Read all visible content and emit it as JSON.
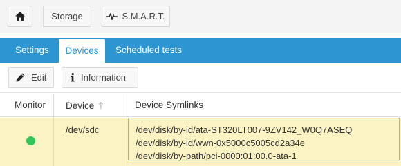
{
  "breadcrumb": {
    "home_icon": "home-icon",
    "storage_label": "Storage",
    "smart_icon": "heartbeat-icon",
    "smart_label": "S.M.A.R.T."
  },
  "tabs": {
    "settings": "Settings",
    "devices": "Devices",
    "scheduled": "Scheduled tests",
    "active": "Devices",
    "accent_color": "#2e95d3"
  },
  "toolbar": {
    "edit_label": "Edit",
    "edit_icon": "pencil-icon",
    "info_label": "Information",
    "info_icon": "info-icon"
  },
  "table": {
    "columns": {
      "monitor": "Monitor",
      "device": "Device",
      "symlinks": "Device Symlinks"
    },
    "sort_icon": "sort-ascending-icon",
    "rows": [
      {
        "monitor_status": "green",
        "device": "/dev/sdc",
        "symlinks": [
          "/dev/disk/by-id/ata-ST320LT007-9ZV142_W0Q7ASEQ",
          "/dev/disk/by-id/wwn-0x5000c5005cd2a34e",
          "/dev/disk/by-path/pci-0000:01:00.0-ata-1"
        ]
      }
    ],
    "selected_row_color": "#fbf3c3",
    "status_color": "#33c55a"
  }
}
